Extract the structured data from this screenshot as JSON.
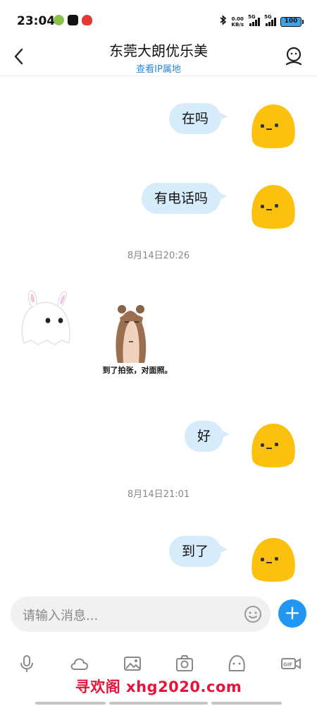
{
  "status_bar": {
    "time": "23:04",
    "net_speed_value": "0.00",
    "net_speed_unit": "KB/s",
    "sim1_label": "5G",
    "sim2_label": "5G",
    "battery": "100"
  },
  "header": {
    "title": "东莞大朗优乐美",
    "subtitle": "查看IP属地"
  },
  "messages": [
    {
      "text": "在吗"
    },
    {
      "text": "有电话吗"
    },
    {
      "text": "好"
    },
    {
      "text": "到了"
    }
  ],
  "timestamps": [
    "8月14日20:26",
    "8月14日21:01"
  ],
  "sticker": {
    "caption": "到了拍张，对面照。"
  },
  "input": {
    "placeholder": "请输入消息..."
  },
  "colors": {
    "accent": "#2196f3",
    "bubble": "#d6ecfb",
    "avatar": "#fcc10e",
    "watermark": "#e6143a"
  },
  "watermark": "寻欢阁 xhg2020.com"
}
